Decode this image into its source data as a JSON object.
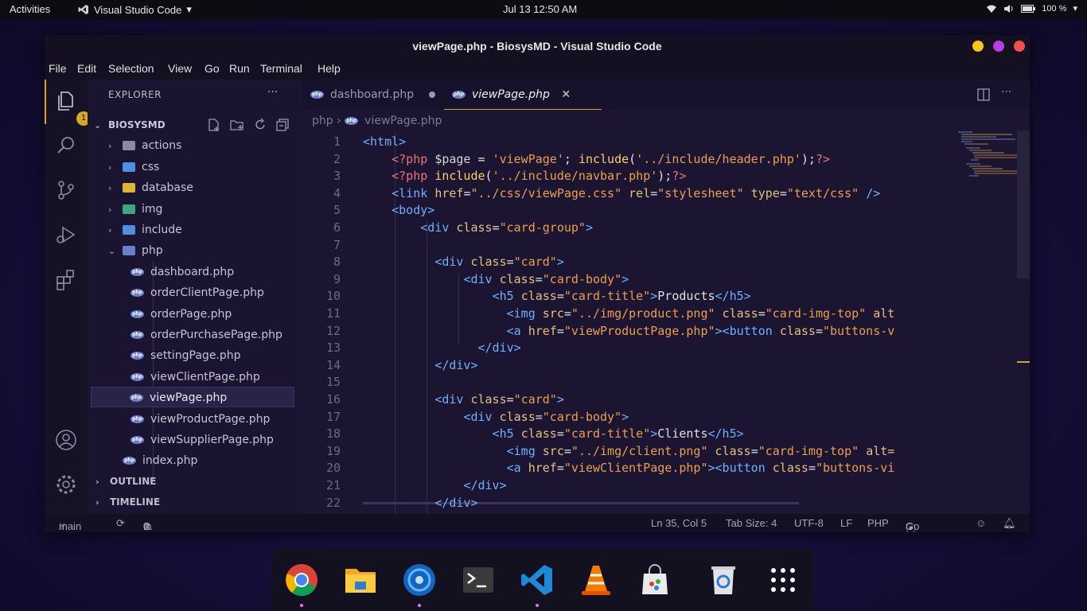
{
  "topbar": {
    "activities": "Activities",
    "app_name": "Visual Studio Code",
    "clock": "Jul 13  12:50 AM",
    "battery": "100 %"
  },
  "window": {
    "title": "viewPage.php - BiosysMD - Visual Studio Code",
    "controls": {
      "minimize_color": "#f5c518",
      "maximize_color": "#b73fe0",
      "close_color": "#ef4f4f"
    }
  },
  "menu": [
    "File",
    "Edit",
    "Selection",
    "View",
    "Go",
    "Run",
    "Terminal",
    "Help"
  ],
  "activity": {
    "explorer_badge": "1"
  },
  "explorer": {
    "header": "EXPLORER",
    "ellipsis": "···",
    "root": "BIOSYSMD",
    "folders": [
      {
        "label": "actions",
        "color": "#8a8a9e"
      },
      {
        "label": "css",
        "color": "#4f8fe0"
      },
      {
        "label": "database",
        "color": "#e0b43b"
      },
      {
        "label": "img",
        "color": "#3ea680"
      },
      {
        "label": "include",
        "color": "#4f8fe0"
      },
      {
        "label": "php",
        "color": "#6b7fd1"
      }
    ],
    "php_files": [
      "dashboard.php",
      "orderClientPage.php",
      "orderPage.php",
      "orderPurchasePage.php",
      "settingPage.php",
      "viewClientPage.php",
      "viewPage.php",
      "viewProductPage.php",
      "viewSupplierPage.php"
    ],
    "root_file": "index.php",
    "outline": "OUTLINE",
    "timeline": "TIMELINE"
  },
  "tabs": [
    {
      "label": "dashboard.php",
      "state": "modified"
    },
    {
      "label": "viewPage.php",
      "state": "active"
    }
  ],
  "breadcrumb": {
    "folder": "php",
    "file": "viewPage.php"
  },
  "editor": {
    "line_numbers": [
      "1",
      "2",
      "3",
      "4",
      "5",
      "6",
      "7",
      "8",
      "9",
      "10",
      "11",
      "12",
      "13",
      "14",
      "15",
      "16",
      "17",
      "18",
      "19",
      "20",
      "21",
      "22"
    ]
  },
  "status": {
    "branch": "main",
    "errors": "0",
    "warnings": "0",
    "position": "Ln 35, Col 5",
    "tab_size": "Tab Size: 4",
    "encoding": "UTF-8",
    "eol": "LF",
    "language": "PHP",
    "go_live": "Go Live"
  },
  "dock": [
    "chrome-icon",
    "files-icon",
    "settings-icon",
    "terminal-icon",
    "vscode-icon",
    "vlc-icon",
    "software-store-icon",
    "trash-icon",
    "app-grid-icon"
  ]
}
